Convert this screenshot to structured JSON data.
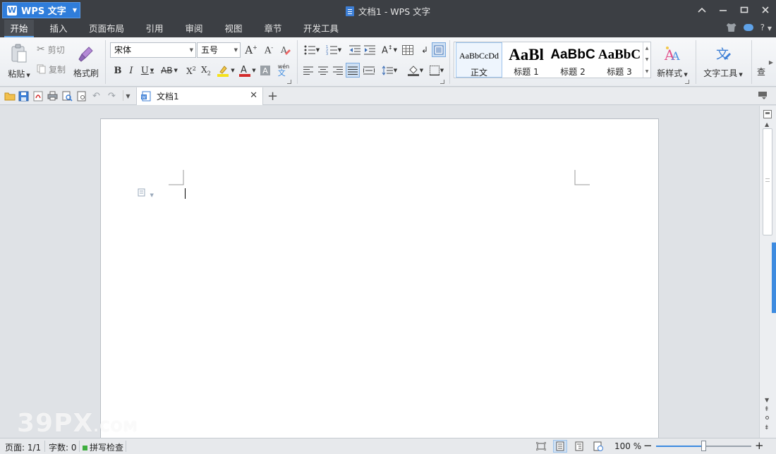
{
  "app": {
    "button_label": "WPS 文字",
    "logo_letter": "W"
  },
  "window": {
    "title": "文档1 - WPS 文字"
  },
  "menu": {
    "tabs": [
      "开始",
      "插入",
      "页面布局",
      "引用",
      "审阅",
      "视图",
      "章节",
      "开发工具"
    ],
    "active_index": 0,
    "help_label": "?"
  },
  "ribbon": {
    "paste": "粘贴",
    "cut": "剪切",
    "copy": "复制",
    "format_painter": "格式刷",
    "font_name": "宋体",
    "font_size": "五号",
    "styles": [
      {
        "sample": "AaBbCcDd",
        "name": "正文"
      },
      {
        "sample": "AaBl",
        "name": "标题 1"
      },
      {
        "sample": "AaBbC",
        "name": "标题 2"
      },
      {
        "sample": "AaBbC",
        "name": "标题 3"
      }
    ],
    "new_style": "新样式",
    "text_tools": "文字工具",
    "overflow_label": "查"
  },
  "doc_tabs": {
    "active_tab": "文档1"
  },
  "status": {
    "page": "页面: 1/1",
    "word_count": "字数: 0",
    "spell_check": "拼写检查",
    "zoom": "100 %",
    "zoom_level_percent": 50
  },
  "watermark": {
    "text": "39PX",
    "suffix": ".COM"
  },
  "colors": {
    "accent": "#3d8be0",
    "titlebar": "#3c3f44",
    "highlight": "#f5e21b",
    "font_color": "#d32b2b"
  }
}
